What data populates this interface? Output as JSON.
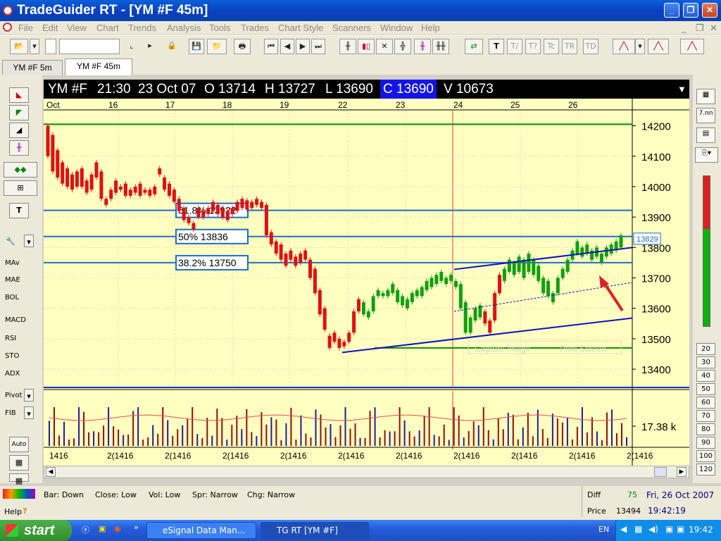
{
  "window": {
    "title": "TradeGuider RT  - [YM #F 45m]",
    "minimize_icon": "minimize-icon",
    "maximize_icon": "maximize-icon",
    "close_icon": "close-icon"
  },
  "menu": [
    "File",
    "Edit",
    "View",
    "Chart",
    "Trends",
    "Analysis",
    "Tools",
    "Trades",
    "Chart Style",
    "Scanners",
    "Window",
    "Help"
  ],
  "tabs": [
    {
      "label": "YM #F 5m",
      "active": false
    },
    {
      "label": "YM #F 45m",
      "active": true
    }
  ],
  "info": {
    "symbol": "YM #F",
    "time": "21:30",
    "date": "23 Oct 07",
    "open": "O 13714",
    "high": "H 13727",
    "low": "L 13690",
    "close": "C 13690",
    "volume": "V 10673"
  },
  "date_axis": [
    "Oct",
    "16",
    "17",
    "18",
    "19",
    "22",
    "23",
    "24",
    "25",
    "26"
  ],
  "price_ticks": [
    "14200",
    "14100",
    "14000",
    "13900",
    "13800",
    "13700",
    "13600",
    "13500",
    "13400"
  ],
  "fib_labels": [
    {
      "text": "61.8% 13922"
    },
    {
      "text": "50% 13836"
    },
    {
      "text": "38.2% 13750"
    }
  ],
  "current_price_tag": "13829",
  "volume_label": "17.38 k",
  "time_ticks": [
    "1416",
    "2(1416",
    "2(1416",
    "2(1416",
    "2(1416",
    "2(1416",
    "2(1416",
    "2(1416",
    "2(1416",
    "2(1416",
    "2(1416"
  ],
  "faded_labels": [
    "Capture Image",
    "Print Screen"
  ],
  "left_panel": [
    "MAv",
    "MAE",
    "BOL",
    "MACD",
    "RSI",
    "STO",
    "ADX",
    "Pivot",
    "FIB",
    "Auto"
  ],
  "right_panel": {
    "buttons": [
      "7.nn"
    ],
    "numbers": [
      "20",
      "30",
      "40",
      "50",
      "60",
      "70",
      "80",
      "90",
      "100",
      "120"
    ]
  },
  "status": {
    "bar": "Bar: Down",
    "close": "Close: Low",
    "vol": "Vol: Low",
    "spr": "Spr: Narrow",
    "chg": "Chg: Narrow",
    "diff_label": "Diff",
    "diff_value": "75",
    "price_label": "Price",
    "price_value": "13494",
    "date": "Fri, 26 Oct 2007",
    "time": "19:42:19",
    "help": "Help"
  },
  "taskbar": {
    "start": "start",
    "tasks": [
      "eSignal Data Man...",
      "TG RT  [YM #F]"
    ],
    "lang": "EN",
    "clock": "19:42"
  },
  "chart_data": {
    "type": "candlestick",
    "symbol": "YM #F",
    "timeframe": "45m",
    "price_axis": {
      "min": 13340,
      "max": 14250,
      "ticks": [
        14200,
        14100,
        14000,
        13900,
        13800,
        13700,
        13600,
        13500,
        13400
      ]
    },
    "dates": [
      "Oct",
      "16",
      "17",
      "18",
      "19",
      "22",
      "23",
      "24",
      "25",
      "26"
    ],
    "horizontal_lines": [
      {
        "price": 14205,
        "color": "#0a8a0a"
      },
      {
        "price": 13922,
        "color": "#1b6ec7",
        "label": "61.8% 13922"
      },
      {
        "price": 13836,
        "color": "#1b6ec7",
        "label": "50% 13836"
      },
      {
        "price": 13750,
        "color": "#1b6ec7",
        "label": "38.2% 13750"
      },
      {
        "price": 13470,
        "color": "#0a8a0a"
      }
    ],
    "bars": [
      [
        14200,
        14100
      ],
      [
        14170,
        14050
      ],
      [
        14120,
        14030
      ],
      [
        14080,
        14010
      ],
      [
        14060,
        14000
      ],
      [
        14040,
        13990
      ],
      [
        14050,
        14000
      ],
      [
        14060,
        14000
      ],
      [
        14020,
        13980
      ],
      [
        14040,
        13990
      ],
      [
        14080,
        14030
      ],
      [
        14050,
        13960
      ],
      [
        13960,
        13940
      ],
      [
        13990,
        13960
      ],
      [
        14020,
        13980
      ],
      [
        14000,
        13990
      ],
      [
        14010,
        13970
      ],
      [
        13990,
        13970
      ],
      [
        14000,
        13980
      ],
      [
        14010,
        13970
      ],
      [
        13990,
        13980
      ],
      [
        13990,
        13970
      ],
      [
        14000,
        13975
      ],
      [
        14060,
        14040
      ],
      [
        14030,
        13990
      ],
      [
        14010,
        13970
      ],
      [
        13990,
        13950
      ],
      [
        13960,
        13920
      ],
      [
        13930,
        13890
      ],
      [
        13900,
        13880
      ],
      [
        13880,
        13860
      ],
      [
        13930,
        13900
      ],
      [
        13920,
        13900
      ],
      [
        13930,
        13910
      ],
      [
        13950,
        13920
      ],
      [
        13940,
        13910
      ],
      [
        13930,
        13900
      ],
      [
        13920,
        13890
      ],
      [
        13930,
        13910
      ],
      [
        13950,
        13920
      ],
      [
        13960,
        13930
      ],
      [
        13955,
        13925
      ],
      [
        13950,
        13930
      ],
      [
        13960,
        13940
      ],
      [
        13950,
        13930
      ],
      [
        13940,
        13840
      ],
      [
        13850,
        13810
      ],
      [
        13820,
        13780
      ],
      [
        13810,
        13760
      ],
      [
        13780,
        13740
      ],
      [
        13790,
        13760
      ],
      [
        13770,
        13740
      ],
      [
        13780,
        13750
      ],
      [
        13790,
        13760
      ],
      [
        13760,
        13700
      ],
      [
        13730,
        13650
      ],
      [
        13660,
        13580
      ],
      [
        13600,
        13530
      ],
      [
        13510,
        13470
      ],
      [
        13520,
        13490
      ],
      [
        13500,
        13470
      ],
      [
        13490,
        13475
      ],
      [
        13520,
        13490
      ],
      [
        13590,
        13520
      ],
      [
        13630,
        13590
      ],
      [
        13620,
        13580
      ],
      [
        13590,
        13570
      ],
      [
        13640,
        13590
      ],
      [
        13660,
        13640
      ],
      [
        13650,
        13640
      ],
      [
        13660,
        13640
      ],
      [
        13680,
        13650
      ],
      [
        13660,
        13620
      ],
      [
        13640,
        13610
      ],
      [
        13630,
        13600
      ],
      [
        13650,
        13620
      ],
      [
        13660,
        13640
      ],
      [
        13670,
        13640
      ],
      [
        13690,
        13660
      ],
      [
        13700,
        13670
      ],
      [
        13710,
        13680
      ],
      [
        13720,
        13690
      ],
      [
        13700,
        13680
      ],
      [
        13710,
        13690
      ],
      [
        13690,
        13670
      ],
      [
        13680,
        13600
      ],
      [
        13620,
        13520
      ],
      [
        13570,
        13520
      ],
      [
        13600,
        13560
      ],
      [
        13610,
        13570
      ],
      [
        13590,
        13550
      ],
      [
        13560,
        13520
      ],
      [
        13650,
        13560
      ],
      [
        13710,
        13650
      ],
      [
        13730,
        13690
      ],
      [
        13760,
        13720
      ],
      [
        13750,
        13710
      ],
      [
        13770,
        13720
      ],
      [
        13760,
        13700
      ],
      [
        13780,
        13720
      ],
      [
        13760,
        13710
      ],
      [
        13740,
        13690
      ],
      [
        13700,
        13650
      ],
      [
        13690,
        13640
      ],
      [
        13650,
        13620
      ],
      [
        13700,
        13650
      ],
      [
        13730,
        13700
      ],
      [
        13760,
        13720
      ],
      [
        13790,
        13760
      ],
      [
        13820,
        13780
      ],
      [
        13800,
        13770
      ],
      [
        13810,
        13780
      ],
      [
        13790,
        13760
      ],
      [
        13800,
        13770
      ],
      [
        13780,
        13750
      ],
      [
        13800,
        13770
      ],
      [
        13810,
        13780
      ],
      [
        13820,
        13790
      ],
      [
        13840,
        13800
      ]
    ],
    "volume_reference": "17.38 k",
    "trend_channel": {
      "color": "#1010c0"
    },
    "annotation": {
      "type": "arrow",
      "color": "#e02020"
    }
  }
}
